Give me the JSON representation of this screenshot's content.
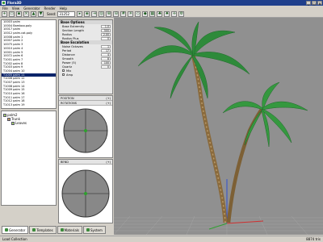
{
  "window": {
    "title": "Flora3D",
    "buttons": [
      "_",
      "□",
      "×"
    ]
  },
  "menu": [
    "File",
    "View",
    "Generator",
    "Render",
    "Help"
  ],
  "toolbar": {
    "seed_label": "Seed:",
    "seed_value": "31252"
  },
  "files": [
    "10003 palm",
    "10004 Bamboo.poly",
    "10017 palm",
    "10012 palm.cat.poly",
    "10008 palm 1",
    "10007 palm 2",
    "10075 palm 3",
    "10010 palm 4",
    "10001 palm 5",
    "10072 palm 6",
    "T1001 palm 7",
    "T1002 palm 8",
    "T1003 palm 9",
    "T1004 palm 10",
    "T1005 palm 11",
    "T1006 palm 12",
    "T1007 palm 13",
    "T1008 palm 14",
    "T1009 palm 15",
    "T1010 palm 16",
    "T1011 palm 17",
    "T1012 palm 18",
    "T1013 palm 19"
  ],
  "selected_index": 14,
  "tree": {
    "root": "palm2",
    "trunk": "Trunk",
    "leaves": "Leaves"
  },
  "props": {
    "group1": "Base Options",
    "group2": "Base Escalation",
    "rows1": [
      {
        "label": "Base Extremity",
        "value": "1.0"
      },
      {
        "label": "Section Length",
        "value": "500"
      },
      {
        "label": "Radius",
        "value": "2.00"
      },
      {
        "label": "Radius Plus",
        "value": "0"
      }
    ],
    "rows2": [
      {
        "label": "Noise Octaves",
        "value": "1"
      },
      {
        "label": "Period",
        "value": "17"
      },
      {
        "label": "Distance",
        "value": "4"
      },
      {
        "label": "Smooth",
        "value": "8"
      },
      {
        "label": "Power (5)",
        "value": "100"
      },
      {
        "label": "Quartz",
        "value": "0"
      }
    ],
    "checks": [
      "Mix",
      "Amp"
    ]
  },
  "position_box": {
    "title": "POSITION",
    "ctrl": "(+)",
    "subtitle": "ROTATIONS",
    "subctrl": "(+)"
  },
  "bend_box": {
    "title": "BEND",
    "ctrl": "(+)"
  },
  "tabs": [
    "Generator",
    "Templates",
    "Materials",
    "System"
  ],
  "status": {
    "left": "Load Collection",
    "right": "8874 tris"
  },
  "colors": {
    "accent": "#1f3f8c",
    "selection": "#0a246a",
    "viewport_bg": "#909090",
    "palm_leaf": "#2e8a3a",
    "trunk": "#8a6a3c"
  }
}
